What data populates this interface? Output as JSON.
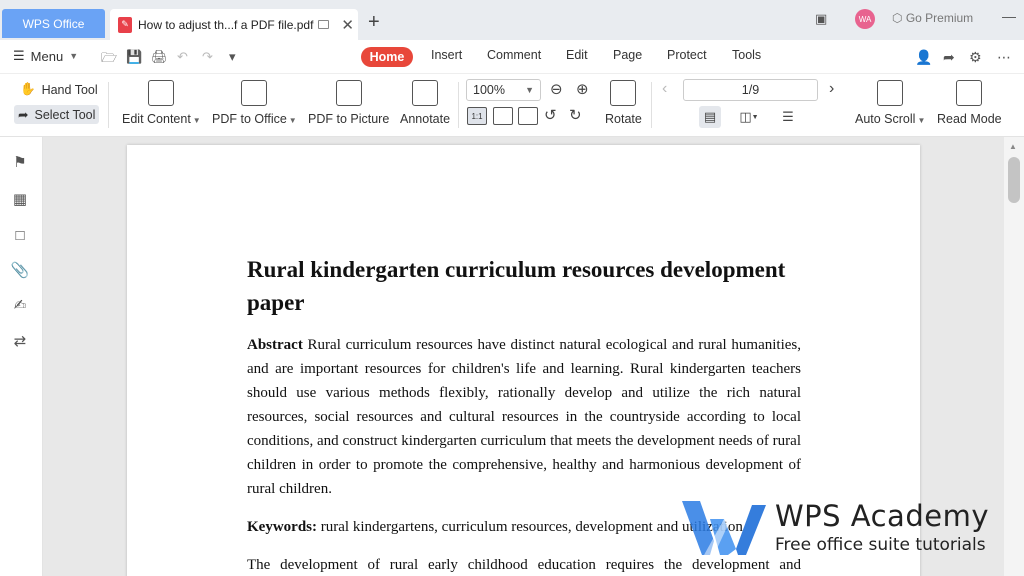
{
  "titlebar": {
    "wps_tab": "WPS Office",
    "doc_tab": "How to adjust th...f a PDF file.pdf",
    "avatar": "WA",
    "premium": "Go Premium"
  },
  "menubar": {
    "menu": "Menu",
    "tabs": [
      "Home",
      "Insert",
      "Comment",
      "Edit",
      "Page",
      "Protect",
      "Tools"
    ]
  },
  "ribbon": {
    "hand_tool": "Hand Tool",
    "select_tool": "Select Tool",
    "edit_content": "Edit Content",
    "pdf_to_office": "PDF to Office",
    "pdf_to_picture": "PDF to Picture",
    "annotate": "Annotate",
    "zoom": "100%",
    "rotate": "Rotate",
    "page_indicator": "1/9",
    "auto_scroll": "Auto Scroll",
    "read_mode": "Read Mode",
    "fit_label": "1:1"
  },
  "document": {
    "title": "Rural kindergarten curriculum resources development paper",
    "abstract_label": "Abstract",
    "abstract_text": "Rural curriculum resources have distinct natural ecological and rural humanities, and are important resources for children's life and learning. Rural kindergarten teachers should use various methods flexibly, rationally develop and utilize the rich natural resources, social resources and cultural resources in the countryside according to local conditions, and construct kindergarten curriculum that meets the development needs of rural children in order to promote the comprehensive, healthy and harmonious development of rural children.",
    "keywords_label": "Keywords:",
    "keywords_text": "rural kindergartens, curriculum resources, development and utilization",
    "body_start": "The development of rural early childhood education requires the development and"
  },
  "watermark": {
    "title": "WPS Academy",
    "subtitle": "Free office suite tutorials"
  },
  "colors": {
    "accent_red": "#e8473a",
    "wps_blue": "#6aa3f5",
    "logo_blue": "#2a7be4"
  }
}
